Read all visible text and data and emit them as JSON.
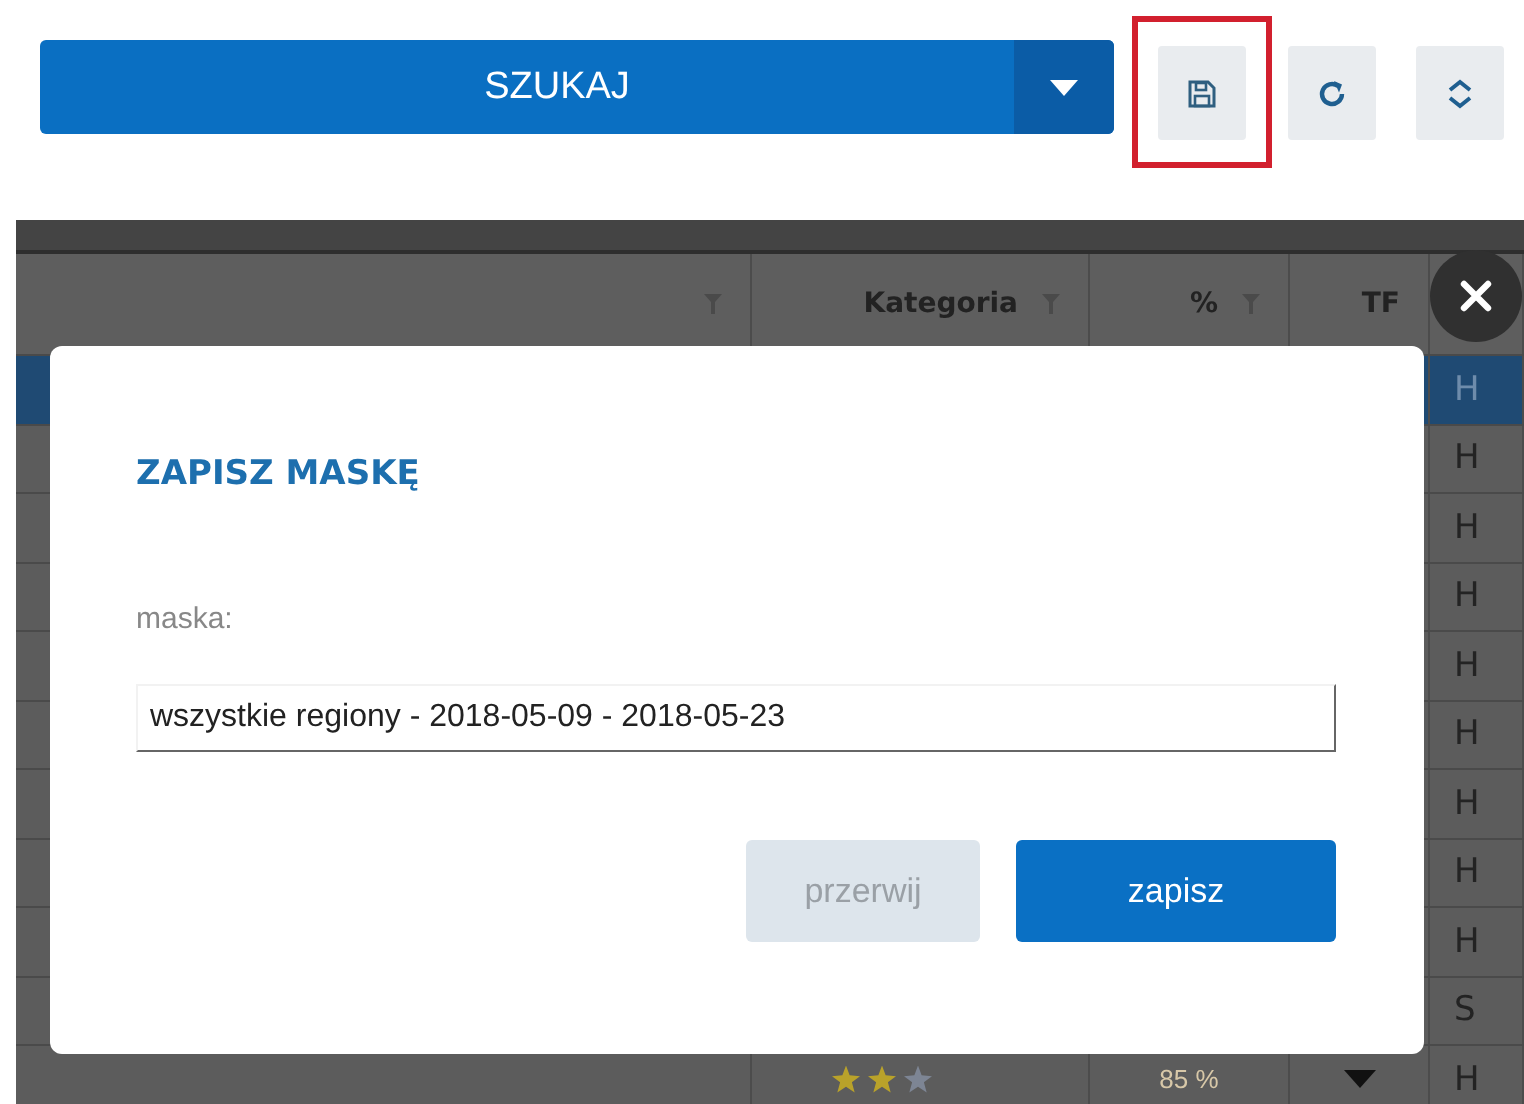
{
  "toolbar": {
    "search_button": "SZUKAJ",
    "icons": [
      {
        "kind": "save",
        "highlighted": true
      },
      {
        "kind": "refresh",
        "highlighted": false
      },
      {
        "kind": "expand",
        "highlighted": false
      }
    ]
  },
  "table": {
    "columns": [
      {
        "kind": "blank",
        "filterable": true
      },
      {
        "kind": "text",
        "label": "Kategoria",
        "filterable": true
      },
      {
        "kind": "text",
        "label": "%",
        "filterable": true
      },
      {
        "kind": "text",
        "label": "TF",
        "filterable": false
      }
    ],
    "rows": [
      {
        "kind": "plain",
        "selected": true,
        "column_5": "H"
      },
      {
        "kind": "plain",
        "selected": false,
        "column_5": "H"
      },
      {
        "kind": "plain",
        "selected": false,
        "column_5": "H"
      },
      {
        "kind": "plain",
        "selected": false,
        "column_5": "H"
      },
      {
        "kind": "plain",
        "selected": false,
        "column_5": "H"
      },
      {
        "kind": "plain",
        "selected": false,
        "column_5": "H"
      },
      {
        "kind": "plain",
        "selected": false,
        "column_5": "H"
      },
      {
        "kind": "plain",
        "selected": false,
        "column_5": "H"
      },
      {
        "kind": "plain",
        "selected": false,
        "column_5": "H"
      },
      {
        "kind": "plain",
        "selected": false,
        "column_5": "S"
      },
      {
        "kind": "rated",
        "selected": false,
        "stars": 2,
        "percent": "85 %",
        "column_5": "H"
      }
    ]
  },
  "modal": {
    "title": "ZAPISZ MASKĘ",
    "field_label": "maska:",
    "field_value": "wszystkie regiony - 2018-05-09 - 2018-05-23",
    "buttons": [
      {
        "kind": "secondary",
        "label": "przerwij"
      },
      {
        "kind": "primary",
        "label": "zapisz"
      }
    ]
  }
}
